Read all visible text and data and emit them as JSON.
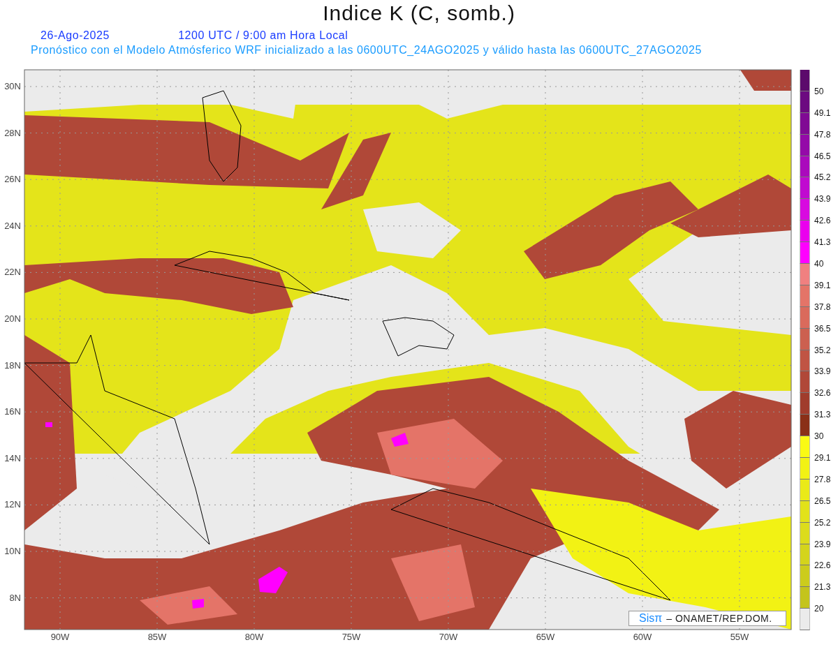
{
  "header": {
    "title": "Indice K (C, somb.)",
    "date": "26-Ago-2025",
    "time": "1200 UTC / 9:00 am Hora Local",
    "subtitle": "Pronóstico con el Modelo Atmósferico WRF inicializado a las 0600UTC_24AGO2025 y válido hasta las  0600UTC_27AGO2025"
  },
  "map": {
    "x_ticks": [
      "90W",
      "85W",
      "80W",
      "75W",
      "70W",
      "65W",
      "60W",
      "55W"
    ],
    "y_ticks": [
      "30N",
      "28N",
      "26N",
      "24N",
      "22N",
      "20N",
      "18N",
      "16N",
      "14N",
      "12N",
      "10N",
      "8N"
    ],
    "credit": {
      "brand": "Sisπ",
      "text": "– ONAMET/REP.DOM."
    }
  },
  "colorbar": {
    "bins": [
      {
        "label": "50",
        "color": "#5c0a6c"
      },
      {
        "label": "49.1",
        "color": "#6c0a80"
      },
      {
        "label": "47.8",
        "color": "#800a94"
      },
      {
        "label": "46.5",
        "color": "#940aa8"
      },
      {
        "label": "45.2",
        "color": "#aa0abc"
      },
      {
        "label": "43.9",
        "color": "#c00ad0"
      },
      {
        "label": "42.6",
        "color": "#d80ae0"
      },
      {
        "label": "41.3",
        "color": "#ea00ee"
      },
      {
        "label": "40",
        "color": "#ff00ff"
      },
      {
        "label": "39.1",
        "color": "#f08080"
      },
      {
        "label": "37.8",
        "color": "#e47468"
      },
      {
        "label": "36.5",
        "color": "#da6a5c"
      },
      {
        "label": "35.2",
        "color": "#cc6050"
      },
      {
        "label": "33.9",
        "color": "#c05444"
      },
      {
        "label": "32.6",
        "color": "#b04838"
      },
      {
        "label": "31.3",
        "color": "#a03c2c"
      },
      {
        "label": "30",
        "color": "#8a3018"
      },
      {
        "label": "29.1",
        "color": "#fafa14"
      },
      {
        "label": "27.8",
        "color": "#f2f214"
      },
      {
        "label": "26.5",
        "color": "#eaea18"
      },
      {
        "label": "25.2",
        "color": "#e2e21a"
      },
      {
        "label": "23.9",
        "color": "#dcdc1c"
      },
      {
        "label": "22.6",
        "color": "#d4d41c"
      },
      {
        "label": "21.3",
        "color": "#cccc1c"
      },
      {
        "label": "20",
        "color": "#c4c41c"
      },
      {
        "color": "#ebebeb"
      }
    ]
  }
}
